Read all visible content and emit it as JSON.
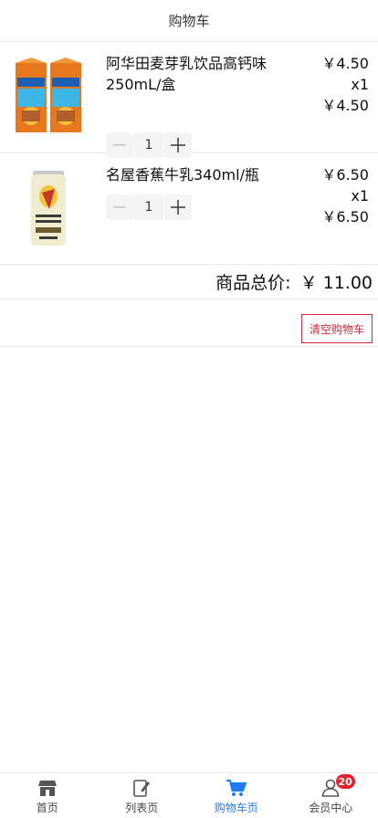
{
  "header": {
    "title": "购物车"
  },
  "cart": {
    "items": [
      {
        "name": "阿华田麦芽乳饮品高钙味250mL/盒",
        "unit_price": "￥4.50",
        "quantity_label": "x1",
        "subtotal": "￥4.50",
        "quantity": "1",
        "image_icon": "ovaltine-carton-pack-image"
      },
      {
        "name": "名屋香蕉牛乳340ml/瓶",
        "unit_price": "￥6.50",
        "quantity_label": "x1",
        "subtotal": "￥6.50",
        "quantity": "1",
        "image_icon": "banana-milk-can-image"
      }
    ]
  },
  "summary": {
    "total_label": "商品总价:",
    "total_amount": "￥ 11.00"
  },
  "actions": {
    "clear_cart": "清空购物车"
  },
  "tabbar": {
    "items": [
      {
        "label": "首页",
        "icon": "store-icon"
      },
      {
        "label": "列表页",
        "icon": "edit-list-icon"
      },
      {
        "label": "购物车页",
        "icon": "cart-icon"
      },
      {
        "label": "会员中心",
        "icon": "user-icon",
        "badge": "20"
      }
    ],
    "active_index": 2
  },
  "colors": {
    "accent": "#1f7bf6",
    "danger": "#d9253a",
    "badge": "#e1222e"
  }
}
